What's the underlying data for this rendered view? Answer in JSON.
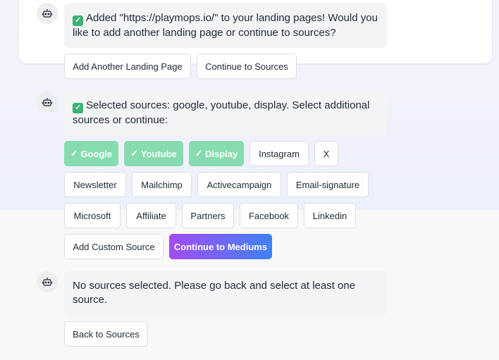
{
  "chat": {
    "msg1": {
      "text": "Added \"https://playmops.io/\" to your landing pages! Would you like to add another landing page or continue to sources?",
      "buttons": [
        "Add Another Landing Page",
        "Continue to Sources"
      ]
    },
    "msg2": {
      "text": "Selected sources: google, youtube, display. Select additional sources or continue:",
      "sources": [
        {
          "label": "Google",
          "selected": true
        },
        {
          "label": "Youtube",
          "selected": true
        },
        {
          "label": "Display",
          "selected": true
        },
        {
          "label": "Instagram",
          "selected": false
        },
        {
          "label": "X",
          "selected": false
        },
        {
          "label": "Newsletter",
          "selected": false
        },
        {
          "label": "Mailchimp",
          "selected": false
        },
        {
          "label": "Activecampaign",
          "selected": false
        },
        {
          "label": "Email-signature",
          "selected": false
        },
        {
          "label": "Microsoft",
          "selected": false
        },
        {
          "label": "Affiliate",
          "selected": false
        },
        {
          "label": "Partners",
          "selected": false
        },
        {
          "label": "Facebook",
          "selected": false
        },
        {
          "label": "Linkedin",
          "selected": false
        }
      ],
      "selected_prefix": "✓",
      "add_custom": "Add Custom Source",
      "continue": "Continue to Mediums"
    },
    "msg3": {
      "text": "No sources selected. Please go back and select at least one source.",
      "back": "Back to Sources"
    }
  },
  "icons": {
    "avatar": "robot-icon",
    "check": "checkmark-box-icon"
  },
  "colors": {
    "selected_source": "#86dcae",
    "primary_gradient_start": "#a34cf3",
    "primary_gradient_end": "#3d82f5",
    "check_box": "#3cb371"
  }
}
